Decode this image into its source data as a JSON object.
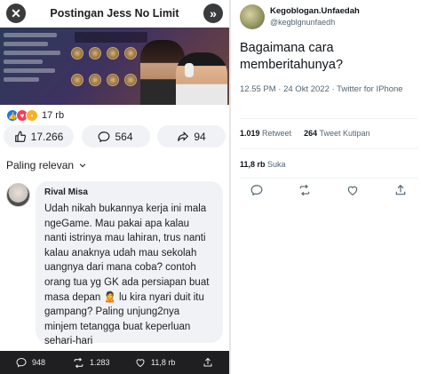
{
  "fb": {
    "title": "Postingan Jess No Limit",
    "close_icon": "close-icon",
    "share_icon": "double-chevron-right-icon",
    "reactions_count": "17 rb",
    "likes": "17.266",
    "comments": "564",
    "shares": "94",
    "sort_label": "Paling relevan",
    "comment": {
      "author": "Rival Misa",
      "text": "Udah nikah bukannya kerja ini mala ngeGame. Mau pakai apa kalau nanti istrinya mau lahiran, trus nanti kalau anaknya udah mau sekolah uangnya dari mana coba? contoh orang tua yg GK ada persiapan buat masa depan 🙎 lu kira nyari duit itu gampang? Paling unjung2nya minjem tetangga buat keperluan sehari-hari"
    },
    "bottom": {
      "replies": "948",
      "retweets": "1.283",
      "likes": "11,8 rb"
    }
  },
  "tw": {
    "name": "Kegoblogan.Unfaedah",
    "handle": "@kegblgnunfaedh",
    "tweet": "Bagaimana cara memberitahunya?",
    "meta": "12.55 PM · 24 Okt 2022 · Twitter for IPhone",
    "retweets_num": "1.019",
    "retweets_label": "Retweet",
    "quotes_num": "264",
    "quotes_label": "Tweet Kutipan",
    "likes_num": "11,8 rb",
    "likes_label": "Suka"
  },
  "colors": {
    "fb_blue": "#1877f2",
    "pill_bg": "#f0f2f5",
    "twitter_gray": "#536471",
    "dark_bar": "#1f1f22"
  }
}
